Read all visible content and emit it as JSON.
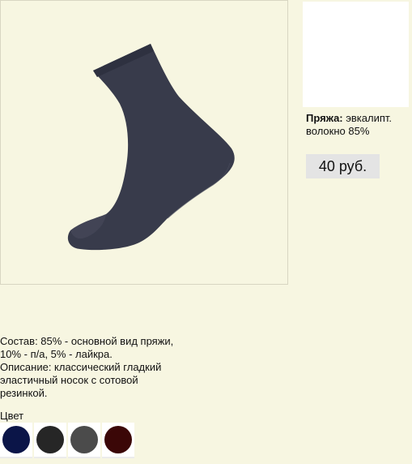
{
  "product": {
    "image_alt": "носок",
    "sock_color": "#383b4b"
  },
  "yarn": {
    "label": "Пряжа:",
    "value": "эвкалипт. волокно 85%"
  },
  "price": "40 руб.",
  "description": {
    "line1": "Состав: 85% - основной вид пряжи,",
    "line2": "10% - п/а, 5% - лайкра.",
    "line3": "Описание: классический гладкий",
    "line4": "эластичный носок с сотовой",
    "line5": "резинкой."
  },
  "colors": {
    "label": "Цвет",
    "options": [
      {
        "name": "navy",
        "hex": "#0b1548"
      },
      {
        "name": "black",
        "hex": "#262626"
      },
      {
        "name": "gray",
        "hex": "#4b4b4b"
      },
      {
        "name": "burgundy",
        "hex": "#3b0707"
      }
    ]
  }
}
